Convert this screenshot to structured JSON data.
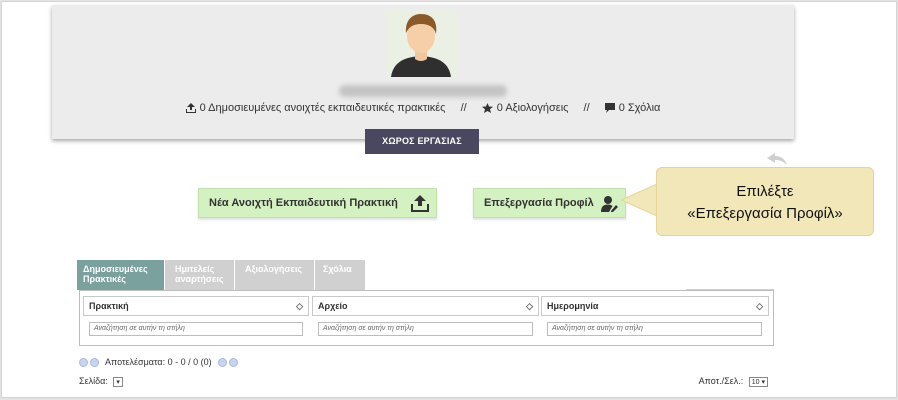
{
  "profile": {
    "stats": {
      "practices": "0 Δημοσιευμένες ανοιχτές εκπαιδευτικές πρακτικές",
      "ratings": "0 Αξιολογήσεις",
      "comments": "0 Σχόλια",
      "separator": "//"
    },
    "icons": [
      "upload-icon",
      "star-icon",
      "comment-icon",
      "avatar"
    ]
  },
  "workspace_tab": "ΧΩΡΟΣ ΕΡΓΑΣΙΑΣ",
  "buttons": {
    "new_practice": "Νέα Ανοιχτή Εκπαιδευτική Πρακτική",
    "edit_profile": "Επεξεργασία Προφίλ"
  },
  "callout": {
    "line1": "Επιλέξτε",
    "line2": "«Επεξεργασία Προφίλ»"
  },
  "tabs": [
    {
      "line1": "Δημοσιευμένες",
      "line2": "Πρακτικές",
      "active": true
    },
    {
      "line1": "Ημιτελείς",
      "line2": "αναρτήσεις",
      "active": false
    },
    {
      "line1": "Αξιολογήσεις",
      "line2": "",
      "active": false
    },
    {
      "line1": "Σχόλια",
      "line2": "",
      "active": false
    }
  ],
  "table": {
    "columns": [
      "Πρακτική",
      "Αρχείο",
      "Ημερομηνία"
    ],
    "filter_placeholder": "Αναζήτηση σε αυτήν τη στήλη",
    "sort_glyph": "◇"
  },
  "pager": {
    "results_label": "Αποτελέσματα:",
    "results_value": "0 - 0 / 0 (0)",
    "page_label": "Σελίδα:",
    "per_page_label": "Αποτ./Σελ.:",
    "per_page_value": "10"
  },
  "colors": {
    "workspace_tab_bg": "#4a4860",
    "button_bg": "#d4f1c2",
    "callout_bg": "#f1e7b8",
    "active_tab_bg": "#7ba19e",
    "inactive_tab_bg": "#d0d0d0"
  }
}
